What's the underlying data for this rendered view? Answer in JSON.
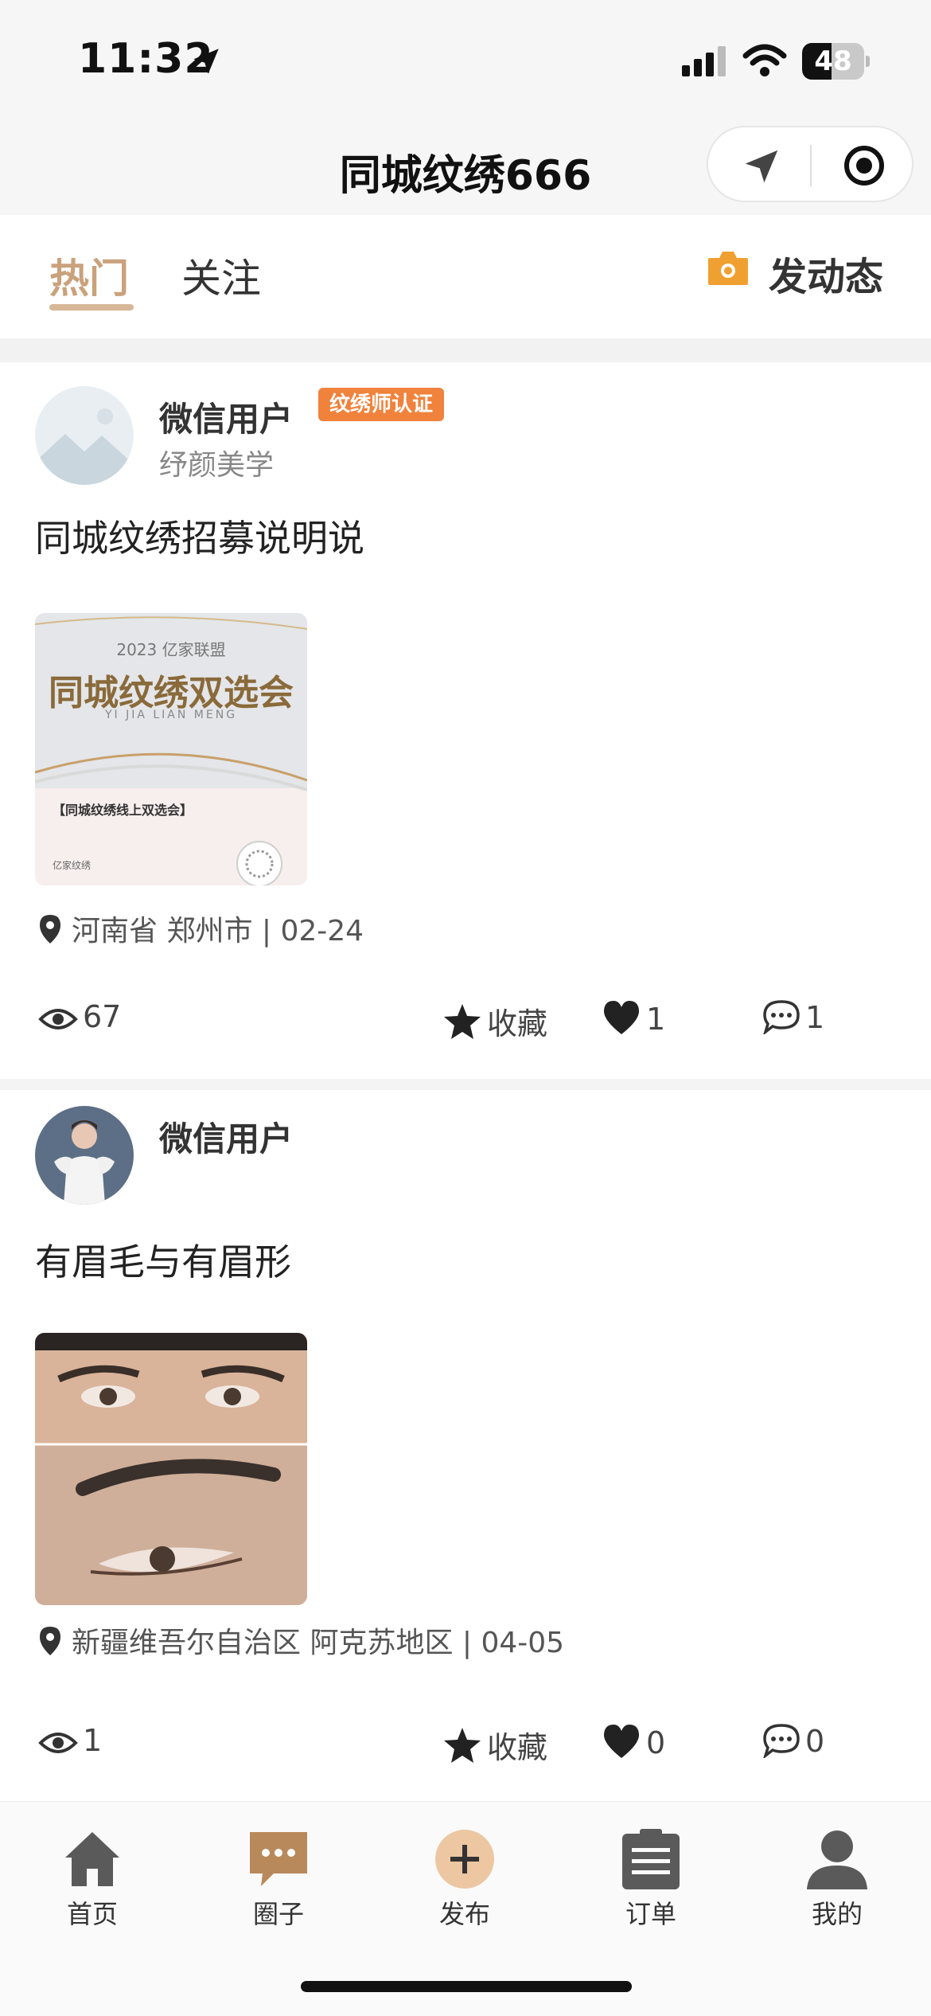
{
  "status_bar": {
    "time": "11:32",
    "battery": "48",
    "battery_level": 0.48
  },
  "nav": {
    "title": "同城纹绣666"
  },
  "tabs": {
    "hot": "热门",
    "follow": "关注",
    "post_button": "发动态"
  },
  "posts": [
    {
      "username": "微信用户",
      "badge": "纹绣师认证",
      "subtitle": "纾颜美学",
      "text": "同城纹绣招募说明说",
      "image": {
        "year_line": "2023 亿家联盟",
        "headline": "同城纹绣双选会",
        "pinyin": "YI JIA LIAN MENG",
        "event": "【同城纹绣线上双选会】",
        "brand": "亿家纹绣"
      },
      "location": "河南省 郑州市 | 02-24",
      "views": "67",
      "favorite_label": "收藏",
      "likes": "1",
      "comments": "1"
    },
    {
      "username": "微信用户",
      "text": "有眉毛与有眉形",
      "location": "新疆维吾尔自治区 阿克苏地区 | 04-05",
      "views": "1",
      "favorite_label": "收藏",
      "likes": "0",
      "comments": "0"
    }
  ],
  "tab_bar": [
    {
      "label": "首页",
      "icon": "home-icon"
    },
    {
      "label": "圈子",
      "icon": "chat-bubble-icon"
    },
    {
      "label": "发布",
      "icon": "plus-icon"
    },
    {
      "label": "订单",
      "icon": "clipboard-icon"
    },
    {
      "label": "我的",
      "icon": "person-icon"
    }
  ],
  "colors": {
    "accent": "#c9a27c",
    "badge": "#f0823c",
    "camera": "#f0a030",
    "tab_icon": "#5a5a5a",
    "circle_icon": "#b8895a"
  }
}
